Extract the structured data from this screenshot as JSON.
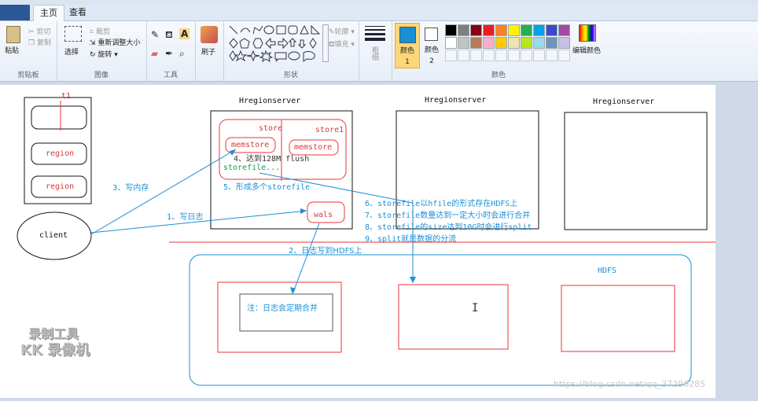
{
  "ribbon": {
    "file_label": "",
    "tabs": [
      "主页",
      "查看"
    ],
    "clipboard": {
      "paste": "粘贴",
      "cut": "剪切",
      "copy": "复制",
      "group": "剪贴板"
    },
    "image": {
      "select": "选择",
      "crop": "裁剪",
      "resize": "重新调整大小",
      "rotate": "旋转",
      "group": "图像"
    },
    "tools": {
      "group": "工具",
      "brush": "刷子"
    },
    "shapes": {
      "outline": "轮廓",
      "fill": "填充",
      "group": "形状"
    },
    "size": {
      "label": "粗细"
    },
    "colors": {
      "color1": "颜色 1",
      "color2": "颜色 2",
      "edit": "编辑颜色",
      "group": "颜色",
      "palette_row1": [
        "#000000",
        "#7f7f7f",
        "#880015",
        "#ed1c24",
        "#ff7f27",
        "#fff200",
        "#22b14c",
        "#00a2e8",
        "#3f48cc",
        "#a349a4"
      ],
      "palette_row2": [
        "#ffffff",
        "#c3c3c3",
        "#b97a57",
        "#ffaec9",
        "#ffc90e",
        "#efe4b0",
        "#b5e61d",
        "#99d9ea",
        "#7092be",
        "#c8bfe7"
      ],
      "primary": "#1a8fd6",
      "secondary": "#ffffff"
    }
  },
  "diagram": {
    "t1": "t1",
    "region1": "region",
    "region2": "region",
    "client": "client",
    "hregion1": "Hregionserver",
    "hregion2": "Hregionserver",
    "hregion3": "Hregionserver",
    "store": "store",
    "store1": "store1",
    "memstore1": "memstore",
    "memstore2": "memstore",
    "flush_note": "4、达到128M flush",
    "storefile": "storefile...",
    "many_storefile": "5、形成多个storefile",
    "write_mem": "3、写内存",
    "write_log": "1、写日志",
    "wals": "wals",
    "log_hdfs": "2、日志写到HDFS上",
    "notes": [
      "6、storefile以hfile的形式存在HDFS上",
      "7、storefile数量达到一定大小时会进行合并",
      "8、storefile的size达到10G时会进行split",
      "9、split就是数据的分流"
    ],
    "hdfs": "HDFS",
    "merge_note": "注：日志会定期合并"
  },
  "watermark": {
    "line1": "录制工具",
    "line2": "KK 录像机",
    "url": "https://blog.csdn.net/qq_37296285"
  }
}
